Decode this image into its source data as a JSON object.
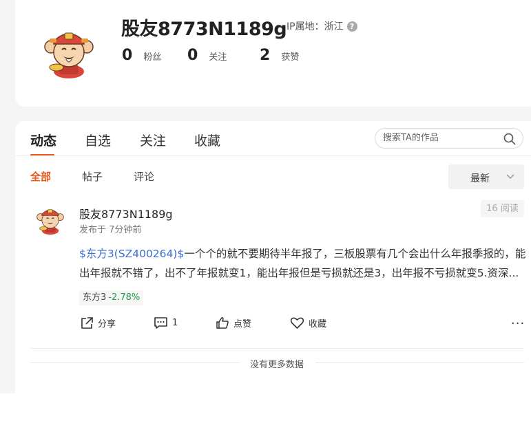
{
  "profile": {
    "username": "股友8773N1189g",
    "ip_label": "IP属地：浙江",
    "help_icon": "question-circle-icon",
    "stats": [
      {
        "num": "0",
        "label": "粉丝"
      },
      {
        "num": "0",
        "label": "关注"
      },
      {
        "num": "2",
        "label": "获赞"
      }
    ]
  },
  "tabs": [
    "动态",
    "自选",
    "关注",
    "收藏"
  ],
  "active_tab": "动态",
  "search": {
    "placeholder": "搜索TA的作品",
    "value": ""
  },
  "subtabs": [
    "全部",
    "帖子",
    "评论"
  ],
  "sort": {
    "selected": "最新"
  },
  "post": {
    "author": "股友8773N1189g",
    "time": "发布于 7分钟前",
    "reads": "16 阅读",
    "stock_link": "$东方3(SZ400264)$",
    "text_line1": "一个个的就不要期待半年报了，三板股票有几个会出什么年报季报的，能",
    "text_line2": "出年报就不错了，出不了年报就变1，能出年报但是亏损就还是3，出年报不亏损就变5.资深...",
    "tag_name": "东方3",
    "tag_change": "-2.78%",
    "actions": {
      "share": "分享",
      "comment_count": "1",
      "like": "点赞",
      "favorite": "收藏"
    },
    "more": "···"
  },
  "footer": {
    "no_more": "没有更多数据"
  },
  "colors": {
    "accent": "#e8581c",
    "stock_link": "#3b6fcf",
    "down": "#1f9a4a"
  }
}
